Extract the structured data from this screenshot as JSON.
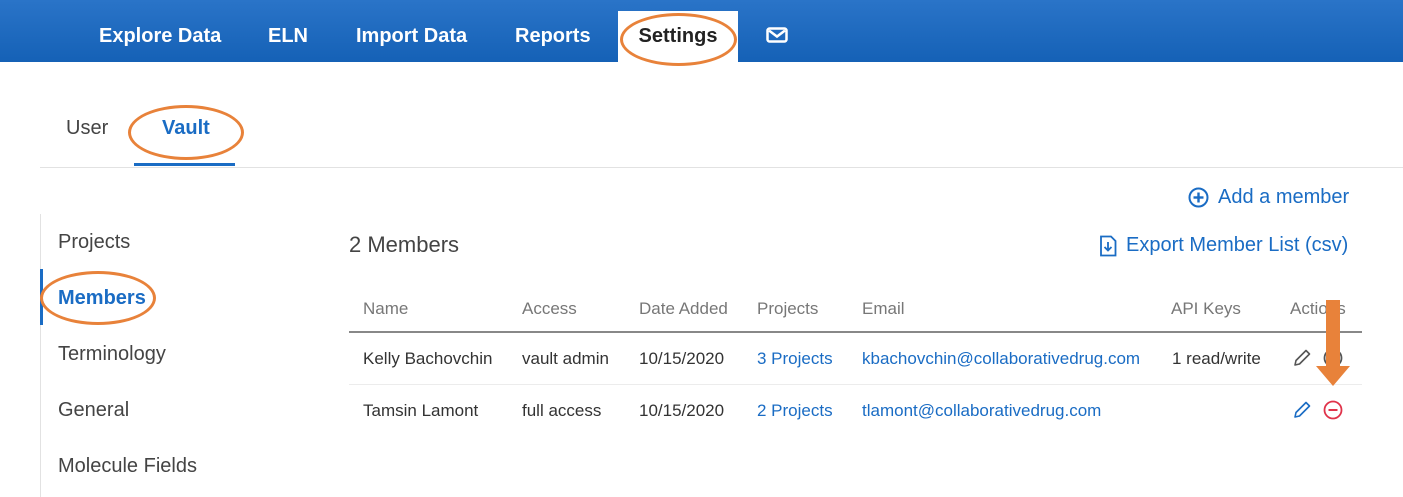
{
  "topnav": {
    "tabs": [
      {
        "label": "Explore Data"
      },
      {
        "label": "ELN"
      },
      {
        "label": "Import Data"
      },
      {
        "label": "Reports"
      },
      {
        "label": "Settings"
      }
    ],
    "mail_icon": "mail-icon"
  },
  "subtabs": [
    {
      "label": "User"
    },
    {
      "label": "Vault"
    }
  ],
  "sidebar": {
    "items": [
      {
        "label": "Projects"
      },
      {
        "label": "Members"
      },
      {
        "label": "Terminology"
      },
      {
        "label": "General"
      },
      {
        "label": "Molecule Fields"
      }
    ]
  },
  "main": {
    "add_member": "Add a member",
    "export": "Export Member List (csv)",
    "members_count": "2 Members",
    "columns": [
      "Name",
      "Access",
      "Date Added",
      "Projects",
      "Email",
      "API Keys",
      "Actions"
    ],
    "rows": [
      {
        "name": "Kelly Bachovchin",
        "access": "vault admin",
        "date_added": "10/15/2020",
        "projects": "3 Projects",
        "email": "kbachovchin@collaborativedrug.com",
        "api_keys": "1 read/write"
      },
      {
        "name": "Tamsin Lamont",
        "access": "full access",
        "date_added": "10/15/2020",
        "projects": "2 Projects",
        "email": "tlamont@collaborativedrug.com",
        "api_keys": ""
      }
    ]
  },
  "colors": {
    "nav_blue": "#1a66bd",
    "link_blue": "#1a6cc4",
    "annotation_orange": "#e8823a",
    "remove_red": "#e0334a"
  }
}
